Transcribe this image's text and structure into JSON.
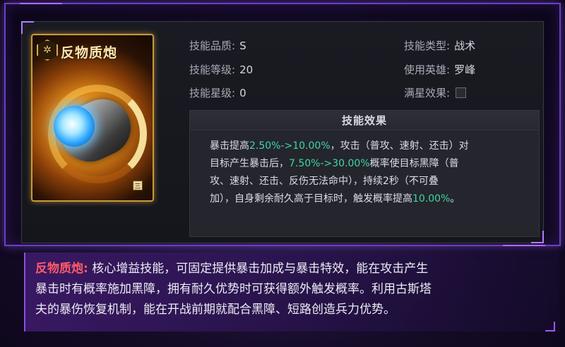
{
  "skill": {
    "name": "反物质炮",
    "card_emblem_icon": "hex-emblem-icon",
    "star_badge": "三"
  },
  "attributes": {
    "quality_label": "技能品质:",
    "quality_value": "S",
    "level_label": "技能等级:",
    "level_value": "20",
    "star_label": "技能星级:",
    "star_value": "0",
    "type_label": "技能类型:",
    "type_value": "战术",
    "hero_label": "使用英雄:",
    "hero_value": "罗峰",
    "full_star_label": "满星效果:",
    "full_star_checked": false
  },
  "effect": {
    "title": "技能效果",
    "t1": "暴击提高",
    "g1": "2.50%->10.00%",
    "t2": "，攻击（普攻、速射、还击）对",
    "t3": "目标产生暴击后，",
    "g2": "7.50%->30.00%",
    "t4": "概率使目标黑障（普",
    "t5": "攻、速射、还击、反伤无法命中），持续2秒（不可叠",
    "t6": "加），自身剩余耐久高于目标时，触发概率提高",
    "g3": "10.00%",
    "t7": "。"
  },
  "description": {
    "title": "反物质炮:",
    "line1": " 核心增益技能，可固定提供暴击加成与暴击特效，能在攻击产生",
    "line2": "暴击时有概率施加黑障，拥有耐久优势时可获得额外触发概率。利用古斯塔",
    "line3": "夫的暴伤恢复机制，能在开战前期就配合黑障、短路创造兵力优势。"
  },
  "colors": {
    "accent_green": "#3fd6a8",
    "accent_red": "#ff5a6a",
    "frame_purple": "#6b3fc0"
  }
}
